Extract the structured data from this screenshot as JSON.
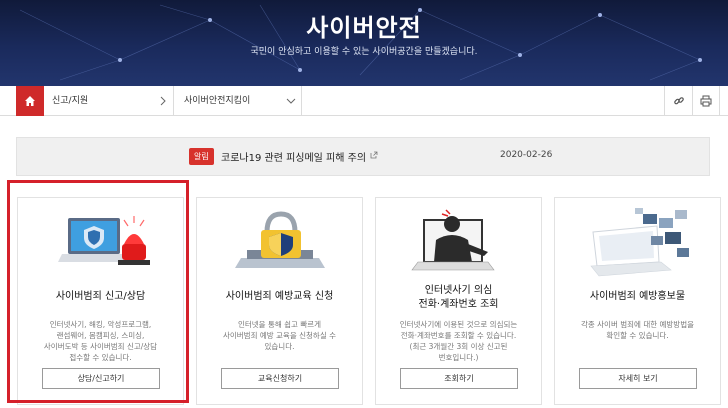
{
  "banner": {
    "title": "사이버안전",
    "subtitle": "국민이 안심하고 이용할 수 있는 사이버공간을 만들겠습니다."
  },
  "breadcrumb": {
    "home_icon": "home-icon",
    "level1": "신고/지원",
    "level2": "사이버안전지킴이"
  },
  "toolbar": {
    "link_icon": "link-icon",
    "print_icon": "print-icon"
  },
  "notice": {
    "badge": "알림",
    "text": "코로나19 관련 피싱메일 피해 주의",
    "date": "2020-02-26"
  },
  "cards": [
    {
      "title": "사이버범죄 신고/상담",
      "desc": [
        "인터넷사기, 해킹, 악성프로그램,",
        "랜섬웨어, 몸캠피싱, 스미싱,",
        "사이버도박 등 사이버범죄 신고/상담",
        "접수할 수 있습니다."
      ],
      "button": "상담/신고하기",
      "icon": "laptop-police-siren-icon"
    },
    {
      "title": "사이버범죄 예방교육 신청",
      "desc": [
        "인터넷을 통해 쉽고 빠르게",
        "사이버범죄 예방 교육을 신청하실 수",
        "있습니다."
      ],
      "button": "교육신청하기",
      "icon": "laptop-lock-shield-icon"
    },
    {
      "title_lines": [
        "인터넷사기 의심",
        "전화·계좌번호 조회"
      ],
      "desc": [
        "인터넷사기에 이용된 것으로 의심되는",
        "전화·계좌번호를 조회할 수 있습니다.",
        "(최근 3개월간 3회 이상 신고된",
        "번호입니다.)"
      ],
      "button": "조회하기",
      "icon": "laptop-hacker-icon"
    },
    {
      "title": "사이버범죄 예방홍보물",
      "desc": [
        "각종 사이버 범죄에 대한 예방방법을",
        "확인할 수 있습니다."
      ],
      "button": "자세히 보기",
      "icon": "laptop-gallery-icon"
    }
  ]
}
